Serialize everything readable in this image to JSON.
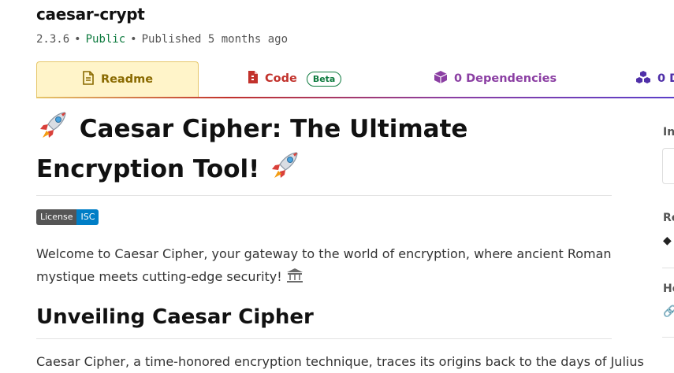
{
  "package": {
    "name": "caesar-crypt",
    "version": "2.3.6",
    "visibility": "Public",
    "published": "Published 5 months ago",
    "separator": "•"
  },
  "tabs": [
    {
      "label": "Readme",
      "icon": "readme-doc-icon",
      "color": "#8a6a00",
      "active": true
    },
    {
      "label": "Code",
      "icon": "code-file-icon",
      "color": "#c2322c",
      "badge": "Beta"
    },
    {
      "label": "0 Dependencies",
      "icon": "cube-icon",
      "color": "#8b3fa3"
    },
    {
      "label": "0 D",
      "icon": "cubes-icon",
      "color": "#4f2fa8"
    }
  ],
  "readme": {
    "title": "Caesar Cipher: The Ultimate Encryption Tool!",
    "license_badge": {
      "left": "License",
      "right": "ISC"
    },
    "intro": "Welcome to Caesar Cipher, your gateway to the world of encryption, where ancient Roman mystique meets cutting-edge security!",
    "section_heading": "Unveiling Caesar Cipher",
    "section_text": "Caesar Cipher, a time-honored encryption technique, traces its origins back to the days of Julius"
  },
  "sidebar": {
    "labels": [
      "In",
      "Re",
      "Ho"
    ]
  },
  "colors": {
    "public": "#0d7a3e",
    "readme_tab_bg": "#fff4c9",
    "license_badge_right": "#007ec6"
  }
}
